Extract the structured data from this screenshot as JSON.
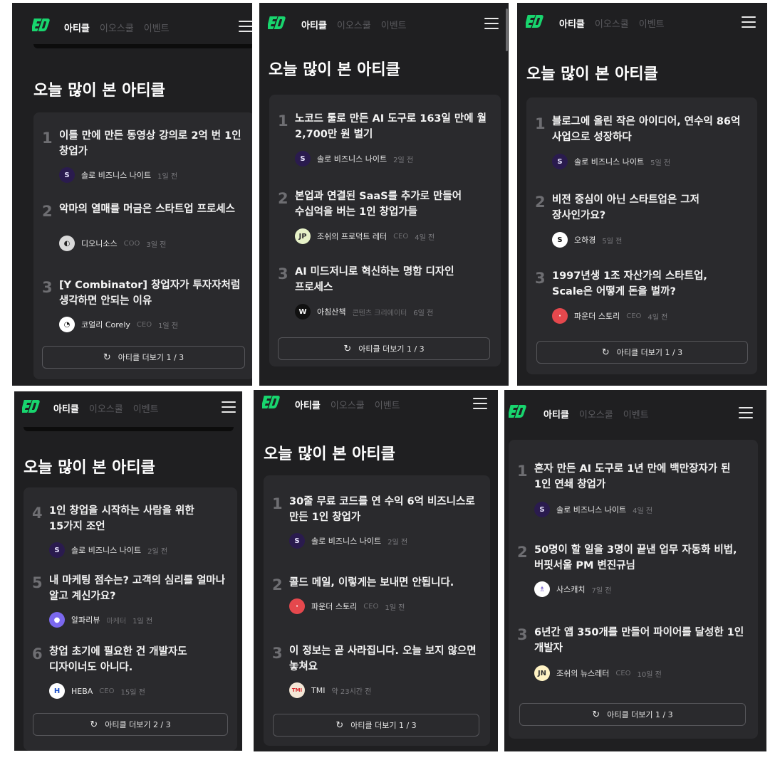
{
  "brand": {
    "accent": "#18d56e",
    "nav": [
      "아티클",
      "이오스쿨",
      "이벤트"
    ]
  },
  "section_title": "오늘 많이 본 아티클",
  "icons": {
    "logo": "eo-logo-icon",
    "menu": "hamburger-menu-icon",
    "reload": "refresh-icon"
  },
  "panels": [
    {
      "more": "아티클 더보기 1 / 3",
      "items": [
        {
          "rank": "1",
          "title": "이틀 만에 만든 동영상 강의로 2억 번 1인 창업가",
          "author": "솔로 비즈니스 나이트",
          "role": "",
          "time": "1일 전"
        },
        {
          "rank": "2",
          "title": "악마의 열매를 머금은 스타트업 프로세스",
          "author": "디오니소스",
          "role": "COO",
          "time": "3일 전"
        },
        {
          "rank": "3",
          "title": "[Y Combinator] 창업자가 투자자처럼 생각하면 안되는 이유",
          "author": "코얼리 Corely",
          "role": "CEO",
          "time": "1일 전"
        }
      ]
    },
    {
      "more": "아티클 더보기 1 / 3",
      "items": [
        {
          "rank": "1",
          "title": "노코드 툴로 만든 AI 도구로 163일 만에 월 2,700만 원 벌기",
          "author": "솔로 비즈니스 나이트",
          "role": "",
          "time": "2일 전"
        },
        {
          "rank": "2",
          "title": "본업과 연결된 SaaS를 추가로 만들어 수십억을 버는 1인 창업가들",
          "author": "조쉬의 프로덕트 레터",
          "role": "CEO",
          "time": "4일 전"
        },
        {
          "rank": "3",
          "title": "AI 미드저니로 혁신하는 명함 디자인 프로세스",
          "author": "아침산책",
          "role": "콘텐츠 크리에이터",
          "time": "6일 전"
        }
      ]
    },
    {
      "more": "아티클 더보기 1 / 3",
      "items": [
        {
          "rank": "1",
          "title": "블로그에 올린 작은 아이디어, 연수익 86억 사업으로 성장하다",
          "author": "솔로 비즈니스 나이트",
          "role": "",
          "time": "5일 전"
        },
        {
          "rank": "2",
          "title": "비전 중심이 아닌 스타트업은 그저 장사인가요?",
          "author": "오하경",
          "role": "",
          "time": "5일 전"
        },
        {
          "rank": "3",
          "title": "1997년생 1조 자산가의 스타트업, Scale은 어떻게 돈을 벌까?",
          "author": "파운더 스토리",
          "role": "CEO",
          "time": "4일 전"
        }
      ]
    },
    {
      "more": "아티클 더보기 2 / 3",
      "items": [
        {
          "rank": "4",
          "title": "1인 창업을 시작하는 사람을 위한 15가지 조언",
          "author": "솔로 비즈니스 나이트",
          "role": "",
          "time": "2일 전"
        },
        {
          "rank": "5",
          "title": "내 마케팅 점수는? 고객의 심리를 얼마나 알고 계신가요?",
          "author": "알파리뷰",
          "role": "마케터",
          "time": "1일 전"
        },
        {
          "rank": "6",
          "title": "창업 초기에 필요한 건 개발자도 디자이너도 아니다.",
          "author": "HEBA",
          "role": "CEO",
          "time": "15일 전"
        }
      ]
    },
    {
      "more": "아티클 더보기 1 / 3",
      "items": [
        {
          "rank": "1",
          "title": "30줄 무료 코드를 연 수익 6억 비즈니스로 만든 1인 창업가",
          "author": "솔로 비즈니스 나이트",
          "role": "",
          "time": "2일 전"
        },
        {
          "rank": "2",
          "title": "콜드 메일, 이렇게는 보내면 안됩니다.",
          "author": "파운더 스토리",
          "role": "CEO",
          "time": "1일 전"
        },
        {
          "rank": "3",
          "title": "이 정보는 곧 사라집니다. 오늘 보지 않으면 놓쳐요",
          "author": "TMI",
          "role": "",
          "time": "약 23시간 전"
        }
      ]
    },
    {
      "more": "아티클 더보기 1 / 3",
      "items": [
        {
          "rank": "1",
          "title": "혼자 만든 AI 도구로 1년 만에 백만장자가 된 1인 연쇄 창업가",
          "author": "솔로 비즈니스 나이트",
          "role": "",
          "time": "4일 전"
        },
        {
          "rank": "2",
          "title": "50명이 할 일을 3명이 끝낸 업무 자동화 비법, 버핏서울 PM 변진규님",
          "author": "사스캐치",
          "role": "",
          "time": "7일 전"
        },
        {
          "rank": "3",
          "title": "6년간 앱 350개를 만들어 파이어를 달성한 1인 개발자",
          "author": "조쉬의 뉴스레터",
          "role": "CEO",
          "time": "10일 전"
        }
      ]
    }
  ]
}
